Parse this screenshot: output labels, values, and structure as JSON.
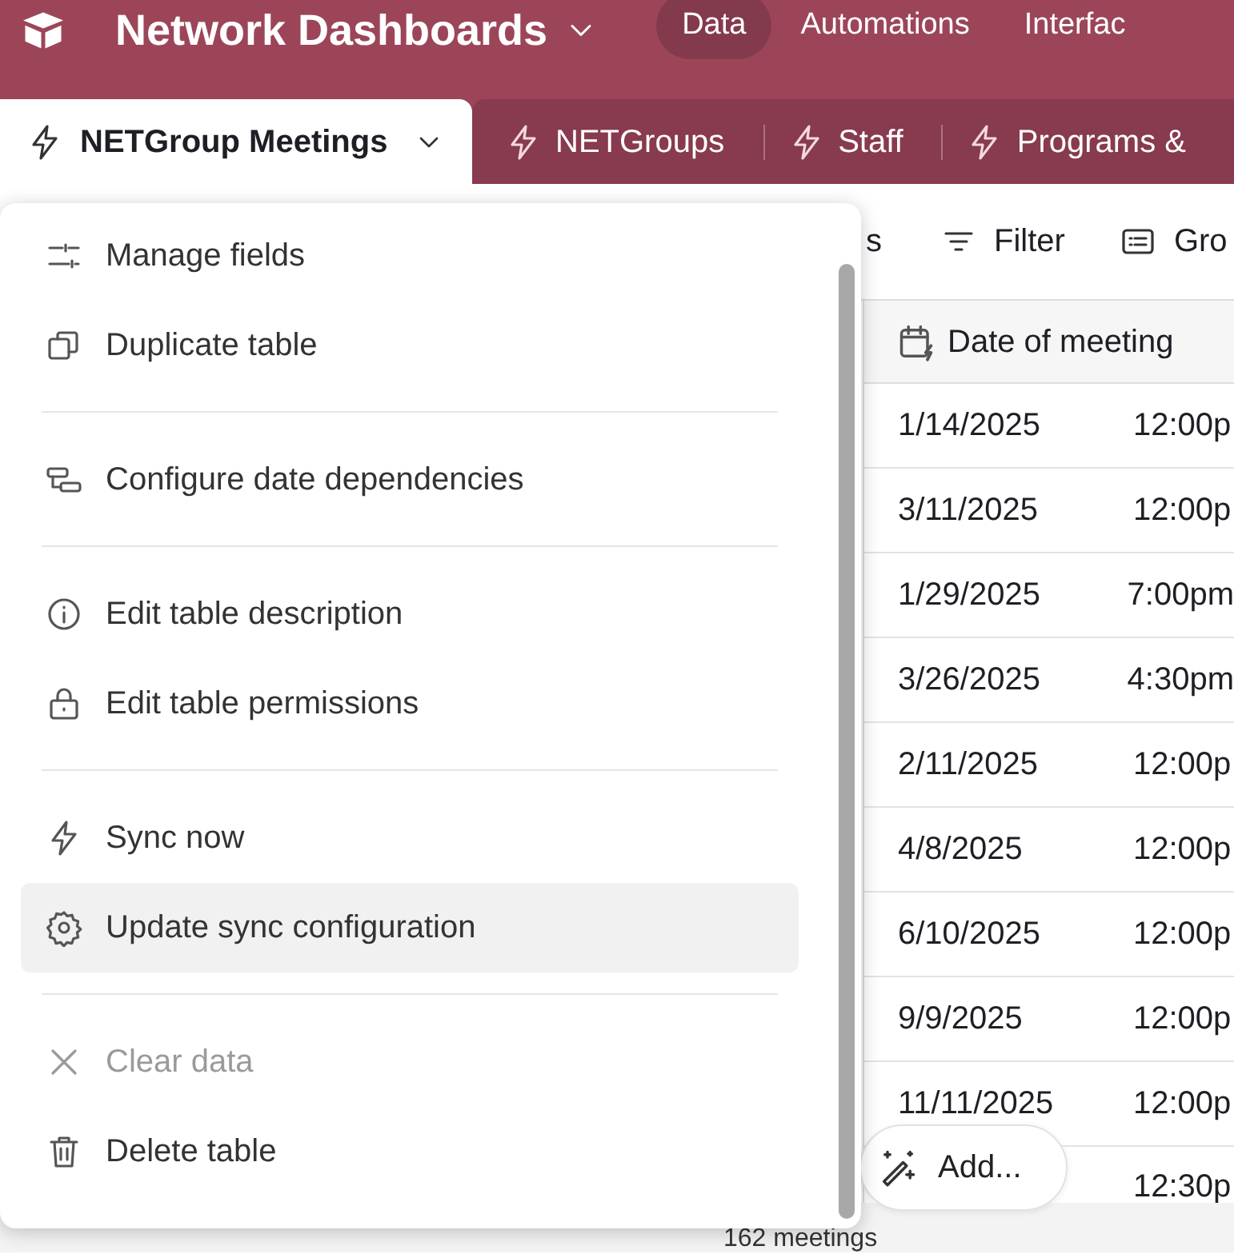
{
  "app": {
    "base_name": "Network Dashboards",
    "nav": [
      {
        "label": "Data",
        "selected": true
      },
      {
        "label": "Automations",
        "selected": false
      },
      {
        "label": "Interfac",
        "selected": false
      }
    ]
  },
  "tables": [
    {
      "label": "NETGroup Meetings",
      "selected": true
    },
    {
      "label": "NETGroups",
      "selected": false
    },
    {
      "label": "Staff",
      "selected": false
    },
    {
      "label": "Programs &",
      "selected": false
    }
  ],
  "toolbar": [
    {
      "label": "s"
    },
    {
      "label": "Filter"
    },
    {
      "label": "Gro"
    }
  ],
  "table": {
    "columns": [
      "Date of meeting"
    ],
    "rows": [
      {
        "date": "1/14/2025",
        "time": "12:00p"
      },
      {
        "date": "3/11/2025",
        "time": "12:00p"
      },
      {
        "date": "1/29/2025",
        "time": "7:00pm"
      },
      {
        "date": "3/26/2025",
        "time": "4:30pm"
      },
      {
        "date": "2/11/2025",
        "time": "12:00p"
      },
      {
        "date": "4/8/2025",
        "time": "12:00p"
      },
      {
        "date": "6/10/2025",
        "time": "12:00p"
      },
      {
        "date": "9/9/2025",
        "time": "12:00p"
      },
      {
        "date": "11/11/2025",
        "time": "12:00p"
      },
      {
        "time": "12:30p"
      }
    ],
    "record_count": "162 meetings"
  },
  "add_button": {
    "label": "Add..."
  },
  "table_menu": {
    "groups": [
      [
        {
          "label": "Manage fields",
          "disabled": false,
          "highlighted": false
        },
        {
          "label": "Duplicate table",
          "disabled": false,
          "highlighted": false
        }
      ],
      [
        {
          "label": "Configure date dependencies",
          "disabled": false,
          "highlighted": false
        }
      ],
      [
        {
          "label": "Edit table description",
          "disabled": false,
          "highlighted": false
        },
        {
          "label": "Edit table permissions",
          "disabled": false,
          "highlighted": false
        }
      ],
      [
        {
          "label": "Sync now",
          "disabled": false,
          "highlighted": false
        },
        {
          "label": "Update sync configuration",
          "disabled": false,
          "highlighted": true
        }
      ],
      [
        {
          "label": "Clear data",
          "disabled": true,
          "highlighted": false
        },
        {
          "label": "Delete table",
          "disabled": false,
          "highlighted": false
        }
      ]
    ]
  }
}
